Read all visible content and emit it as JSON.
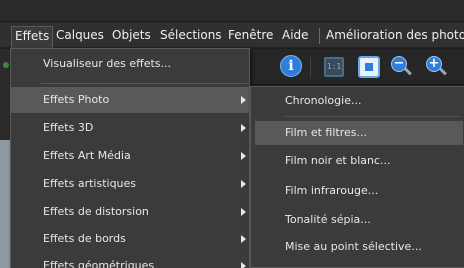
{
  "menubar": {
    "items": [
      {
        "label": "Effets"
      },
      {
        "label": "Calques"
      },
      {
        "label": "Objets"
      },
      {
        "label": "Sélections"
      },
      {
        "label": "Fenêtre"
      },
      {
        "label": "Aide"
      },
      {
        "label": "Amélioration des photos"
      }
    ],
    "active": "Effets"
  },
  "toolbar": {
    "info_glyph": "i",
    "actual_size_glyph": "1:1",
    "zoom_out_glyph": "−",
    "zoom_in_glyph": "+",
    "icons": [
      "info-icon",
      "actual-size-icon",
      "fit-to-window-icon",
      "zoom-out-icon",
      "zoom-in-icon"
    ]
  },
  "effects_menu": {
    "items": [
      {
        "label": "Visualiseur des effets...",
        "submenu": false
      },
      {
        "label": "Effets Photo",
        "submenu": true,
        "selected": true
      },
      {
        "label": "Effets 3D",
        "submenu": true
      },
      {
        "label": "Effets Art Média",
        "submenu": true
      },
      {
        "label": "Effets artistiques",
        "submenu": true
      },
      {
        "label": "Effets de distorsion",
        "submenu": true
      },
      {
        "label": "Effets de bords",
        "submenu": true
      },
      {
        "label": "Effets géométriques",
        "submenu": true
      }
    ]
  },
  "photo_effects_submenu": {
    "items": [
      {
        "label": "Chronologie..."
      },
      {
        "label": "Film et filtres...",
        "selected": true
      },
      {
        "label": "Film noir et blanc..."
      },
      {
        "label": "Film infrarouge..."
      },
      {
        "label": "Tonalité sépia..."
      },
      {
        "label": "Mise au point sélective..."
      }
    ]
  },
  "colors": {
    "menu_bg": "#3b3b3b",
    "highlight": "#595959",
    "accent_blue": "#2f7fd8"
  }
}
